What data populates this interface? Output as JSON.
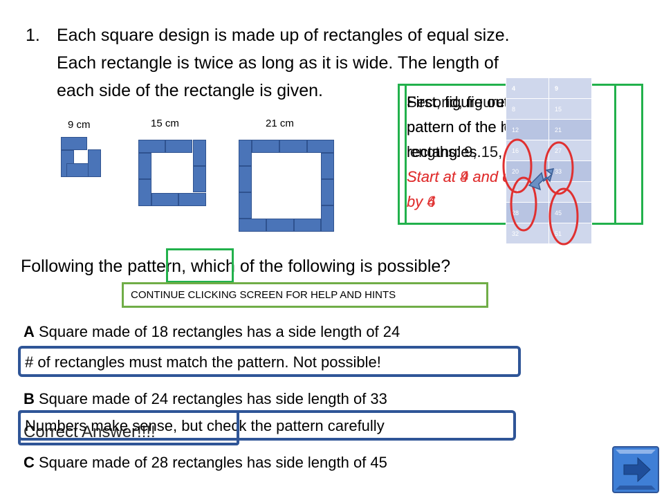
{
  "question": {
    "number": "1.",
    "line1": "Each square design is made up of rectangles of equal size.",
    "line2": "Each rectangle is twice as long as it is wide.  The length of",
    "line3": "each side of the rectangle is given."
  },
  "figures": {
    "labels": [
      "9 cm",
      "15 cm",
      "21 cm"
    ]
  },
  "hint_overlay": {
    "text_a1": "First, figure out the",
    "text_a2": "pattern of the number of",
    "text_a3": "rectangles.",
    "text_b1": "Second, figure out the",
    "text_b2": "pattern of the length",
    "text_b3": "lengths: 9, 15, 21...",
    "red_a1": "Start at 4 and count",
    "red_a2": "by 4",
    "red_b1": "Start at 9 and count",
    "red_b2": "by 6"
  },
  "sequence_table": {
    "headers": [
      "4",
      "9"
    ],
    "rows": [
      [
        "8",
        "15"
      ],
      [
        "12",
        "21"
      ],
      [
        "16",
        "27"
      ],
      [
        "20",
        "33"
      ],
      [
        "24",
        "39"
      ],
      [
        "28",
        "45"
      ],
      [
        "32",
        "51"
      ]
    ]
  },
  "prompt": {
    "before": "Following the ",
    "highlight": "pattern,",
    "after": " which of the following is possible?"
  },
  "help_button": "CONTINUE CLICKING  SCREEN FOR HELP AND HINTS",
  "answers": {
    "a_letter": "A",
    "a_text": " Square made of 18 rectangles  has a side length of 24",
    "a_feedback": "# of rectangles must match the pattern.  Not possible!",
    "b_letter": "B",
    "b_text": " Square made of 24 rectangles has side length of 33",
    "b_feedback": "Numbers make sense, but check the pattern carefully",
    "c_letter": "C",
    "c_text": " Square made of 28 rectangles has side length of 45",
    "correct_label": "Correct Answer!!!!"
  },
  "colors": {
    "rect_fill": "#4a74b8",
    "green_outline": "#22b14c",
    "blue_outline": "#2f5597",
    "red_annotation": "#e03030",
    "nav_button": "#3f7fd6"
  }
}
